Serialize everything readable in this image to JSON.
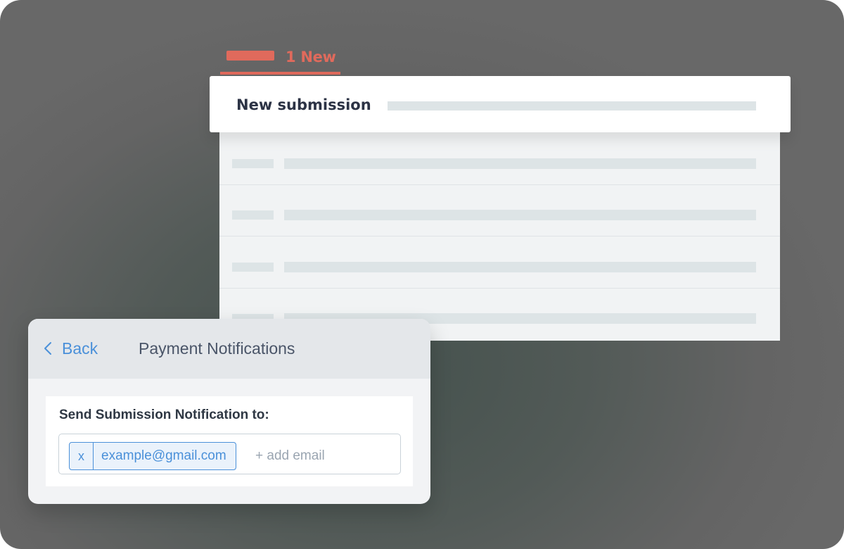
{
  "submissions": {
    "new_tab_label": "1 New",
    "header_title": "New submission",
    "row_count": 4
  },
  "notifications": {
    "back_label": "Back",
    "title": "Payment Notifications",
    "field_label": "Send Submission Notification to:",
    "chip": {
      "remove_label": "x",
      "email": "example@gmail.com"
    },
    "add_email_placeholder": "+ add email"
  },
  "colors": {
    "accent_red": "#e06a5c",
    "link_blue": "#4a90d9",
    "title_dark": "#2c3345"
  }
}
